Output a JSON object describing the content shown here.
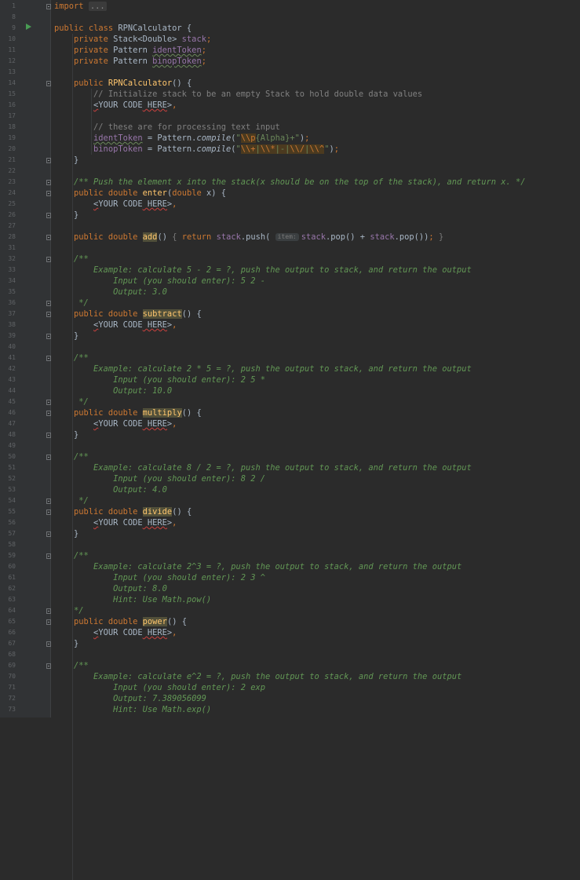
{
  "editor": {
    "language": "Java",
    "gutter_marks": {
      "run_line": "9",
      "icon": "run-gutter-icon"
    },
    "lines": [
      {
        "n": "1",
        "text": "import ..."
      },
      {
        "n": "8",
        "text": ""
      },
      {
        "n": "9",
        "text": "public class RPNCalculator {"
      },
      {
        "n": "10",
        "text": "    private Stack<Double> stack;"
      },
      {
        "n": "11",
        "text": "    private Pattern identToken;"
      },
      {
        "n": "12",
        "text": "    private Pattern binopToken;"
      },
      {
        "n": "13",
        "text": ""
      },
      {
        "n": "14",
        "text": "    public RPNCalculator() {"
      },
      {
        "n": "15",
        "text": "        // Initialize stack to be an empty Stack to hold double data values"
      },
      {
        "n": "16",
        "text": "        <YOUR CODE HERE>"
      },
      {
        "n": "17",
        "text": ""
      },
      {
        "n": "18",
        "text": "        // these are for processing text input"
      },
      {
        "n": "19",
        "text": "        identToken = Pattern.compile(\"\\\\p{Alpha}+\");"
      },
      {
        "n": "20",
        "text": "        binopToken = Pattern.compile(\"\\\\+|\\\\*|-|\\\\/|\\\\^\");"
      },
      {
        "n": "21",
        "text": "    }"
      },
      {
        "n": "22",
        "text": ""
      },
      {
        "n": "23",
        "text": "    /** Push the element x into the stack(x should be on the top of the stack), and return x. */"
      },
      {
        "n": "24",
        "text": "    public double enter(double x) {"
      },
      {
        "n": "25",
        "text": "        <YOUR CODE HERE>"
      },
      {
        "n": "26",
        "text": "    }"
      },
      {
        "n": "27",
        "text": ""
      },
      {
        "n": "28",
        "text": "    public double add() { return stack.push( item: stack.pop() + stack.pop()); }"
      },
      {
        "n": "31",
        "text": ""
      },
      {
        "n": "32",
        "text": "    /**"
      },
      {
        "n": "33",
        "text": "        Example: calculate 5 - 2 = ?, push the output to stack, and return the output"
      },
      {
        "n": "34",
        "text": "            Input (you should enter): 5 2 -"
      },
      {
        "n": "35",
        "text": "            Output: 3.0"
      },
      {
        "n": "36",
        "text": "     */"
      },
      {
        "n": "37",
        "text": "    public double subtract() {"
      },
      {
        "n": "38",
        "text": "        <YOUR CODE HERE>"
      },
      {
        "n": "39",
        "text": "    }"
      },
      {
        "n": "40",
        "text": ""
      },
      {
        "n": "41",
        "text": "    /**"
      },
      {
        "n": "42",
        "text": "        Example: calculate 2 * 5 = ?, push the output to stack, and return the output"
      },
      {
        "n": "43",
        "text": "            Input (you should enter): 2 5 *"
      },
      {
        "n": "44",
        "text": "            Output: 10.0"
      },
      {
        "n": "45",
        "text": "     */"
      },
      {
        "n": "46",
        "text": "    public double multiply() {"
      },
      {
        "n": "47",
        "text": "        <YOUR CODE HERE>"
      },
      {
        "n": "48",
        "text": "    }"
      },
      {
        "n": "49",
        "text": ""
      },
      {
        "n": "50",
        "text": "    /**"
      },
      {
        "n": "51",
        "text": "        Example: calculate 8 / 2 = ?, push the output to stack, and return the output"
      },
      {
        "n": "52",
        "text": "            Input (you should enter): 8 2 /"
      },
      {
        "n": "53",
        "text": "            Output: 4.0"
      },
      {
        "n": "54",
        "text": "     */"
      },
      {
        "n": "55",
        "text": "    public double divide() {"
      },
      {
        "n": "56",
        "text": "        <YOUR CODE HERE>"
      },
      {
        "n": "57",
        "text": "    }"
      },
      {
        "n": "58",
        "text": ""
      },
      {
        "n": "59",
        "text": "    /**"
      },
      {
        "n": "60",
        "text": "        Example: calculate 2^3 = ?, push the output to stack, and return the output"
      },
      {
        "n": "61",
        "text": "            Input (you should enter): 2 3 ^"
      },
      {
        "n": "62",
        "text": "            Output: 8.0"
      },
      {
        "n": "63",
        "text": "            Hint: Use Math.pow()"
      },
      {
        "n": "64",
        "text": "    */"
      },
      {
        "n": "65",
        "text": "    public double power() {"
      },
      {
        "n": "66",
        "text": "        <YOUR CODE HERE>"
      },
      {
        "n": "67",
        "text": "    }"
      },
      {
        "n": "68",
        "text": ""
      },
      {
        "n": "69",
        "text": "    /**"
      },
      {
        "n": "70",
        "text": "        Example: calculate e^2 = ?, push the output to stack, and return the output"
      },
      {
        "n": "71",
        "text": "            Input (you should enter): 2 exp"
      },
      {
        "n": "72",
        "text": "            Output: 7.389056099"
      },
      {
        "n": "73",
        "text": "            Hint: Use Math.exp()"
      }
    ]
  }
}
